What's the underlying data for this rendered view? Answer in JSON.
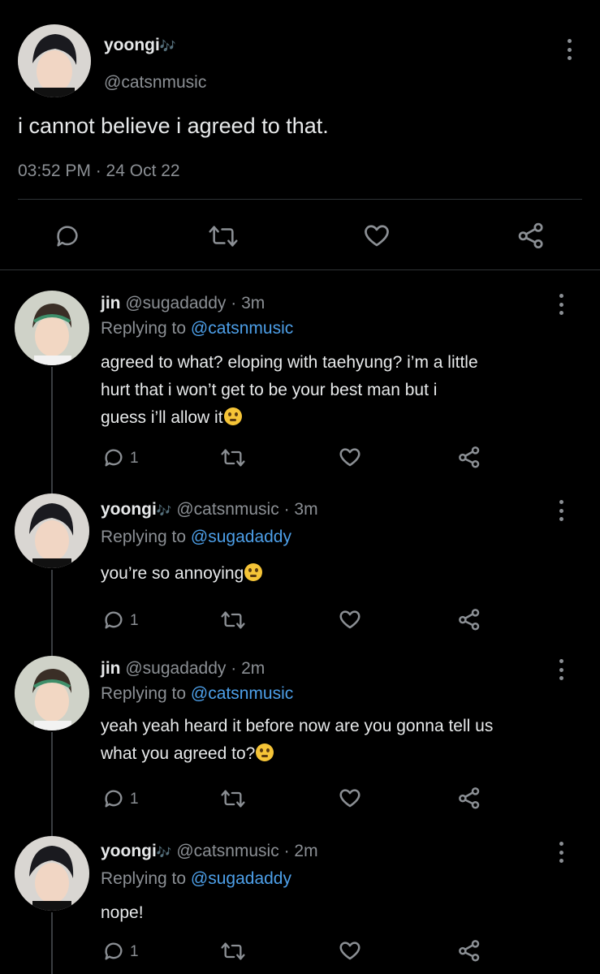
{
  "main_tweet": {
    "display_name": "yoongi",
    "name_emoji": "🎶",
    "handle": "@catsnmusic",
    "text": "i cannot believe i agreed to that.",
    "timestamp": "03:52 PM · 24 Oct 22"
  },
  "replies": [
    {
      "display_name": "jin",
      "handle": "@sugadaddy",
      "time": "· 3m",
      "replying_prefix": "Replying to",
      "replying_to": "@catsnmusic",
      "text_lines": [
        "agreed to what? eloping with taehyung? i’m a little",
        "hurt that i won’t get to be your best man but i",
        "guess i’ll allow it"
      ],
      "emoji": "thinking-face-emoji",
      "reply_count": "1"
    },
    {
      "display_name": "yoongi",
      "name_emoji": "🎶",
      "handle": "@catsnmusic",
      "time": "· 3m",
      "replying_prefix": "Replying to",
      "replying_to": "@sugadaddy",
      "text_lines": [
        "you’re so annoying"
      ],
      "emoji": "eye-roll-emoji",
      "reply_count": "1"
    },
    {
      "display_name": "jin",
      "handle": "@sugadaddy",
      "time": "· 2m",
      "replying_prefix": "Replying to",
      "replying_to": "@catsnmusic",
      "text_lines": [
        "yeah yeah heard it before now are you gonna tell us",
        "what you agreed to?"
      ],
      "emoji": "kissing-face-emoji",
      "reply_count": "1"
    },
    {
      "display_name": "yoongi",
      "name_emoji": "🎶",
      "handle": "@catsnmusic",
      "time": "· 2m",
      "replying_prefix": "Replying to",
      "replying_to": "@sugadaddy",
      "text_lines": [
        "nope!"
      ],
      "emoji": "",
      "reply_count": "1"
    }
  ],
  "icons": [
    "more-icon",
    "reply-icon",
    "retweet-icon",
    "like-icon",
    "share-icon"
  ],
  "colors": {
    "background": "#000000",
    "text": "#e7e9ea",
    "muted": "#8b8f94",
    "link": "#4d9fe8",
    "divider": "#2f3336"
  }
}
